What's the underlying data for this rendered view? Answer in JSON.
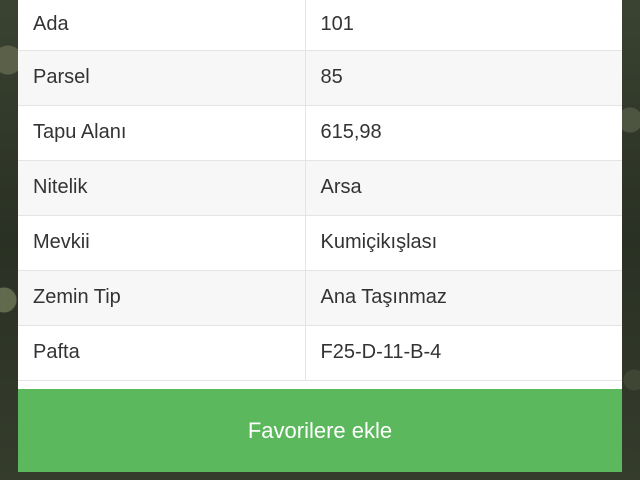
{
  "parcel_info": {
    "rows": [
      {
        "label": "Ada",
        "value": "101"
      },
      {
        "label": "Parsel",
        "value": "85"
      },
      {
        "label": "Tapu Alanı",
        "value": "615,98"
      },
      {
        "label": "Nitelik",
        "value": "Arsa"
      },
      {
        "label": "Mevkii",
        "value": "Kumiçikışlası"
      },
      {
        "label": "Zemin Tip",
        "value": "Ana Taşınmaz"
      },
      {
        "label": "Pafta",
        "value": "F25-D-11-B-4"
      }
    ]
  },
  "actions": {
    "add_favorites_label": "Favorilere ekle"
  },
  "colors": {
    "button": "#5cb85c",
    "background": "#2b3226"
  }
}
